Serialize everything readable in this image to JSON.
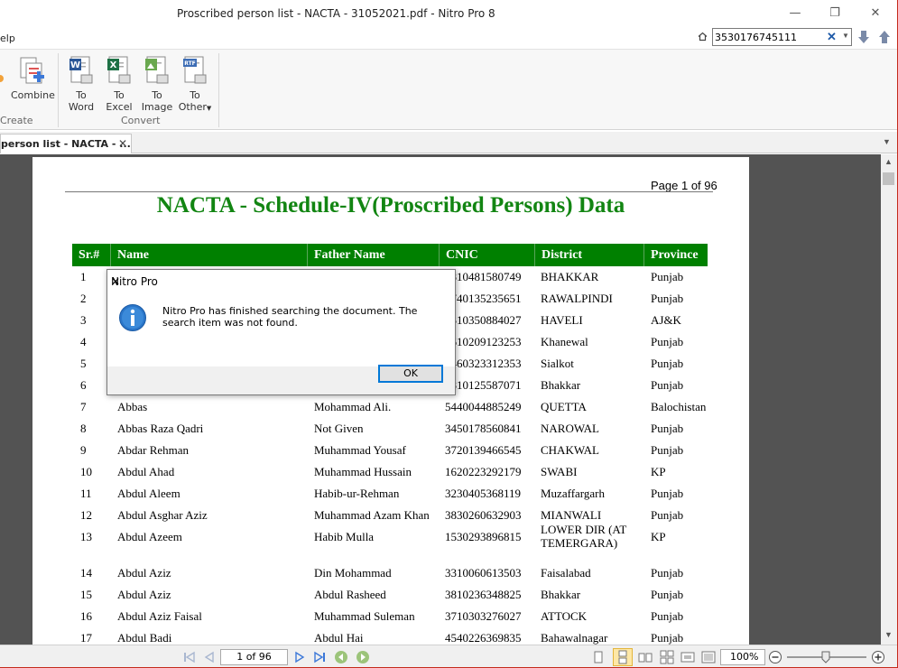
{
  "window": {
    "title": "Proscribed person list - NACTA - 31052021.pdf - Nitro Pro 8",
    "minimize_glyph": "—",
    "restore_glyph": "❐",
    "close_glyph": "✕"
  },
  "menu": {
    "help": "elp"
  },
  "search": {
    "value": "3530176745111",
    "clear_glyph": "✕"
  },
  "ribbon": {
    "create_group": {
      "combine_label": "Combine",
      "group_label": "Create"
    },
    "convert_group": {
      "group_label": "Convert",
      "buttons": [
        {
          "line1": "To",
          "line2": "Word",
          "icon": "word-icon",
          "badge": "W",
          "color": "#2b5797"
        },
        {
          "line1": "To",
          "line2": "Excel",
          "icon": "excel-icon",
          "badge": "X",
          "color": "#1e7145"
        },
        {
          "line1": "To",
          "line2": "Image",
          "icon": "image-icon",
          "badge": "IMG",
          "color": "#6aa84f"
        },
        {
          "line1": "To",
          "line2": "Other",
          "icon": "other-icon",
          "badge": "RTF",
          "color": "#3d6db5"
        }
      ]
    }
  },
  "tab": {
    "label": "person list - NACTA - ...",
    "close_glyph": "✕"
  },
  "document": {
    "page_label": "Page 1 of 96",
    "title": "NACTA - Schedule-IV(Proscribed Persons) Data",
    "columns": [
      "Sr.#",
      "Name",
      "Father Name",
      "CNIC",
      "District",
      "Province"
    ],
    "rows": [
      {
        "sr": "1",
        "name": "",
        "father": "",
        "cnic": "3810481580749",
        "district": "BHAKKAR",
        "province": "Punjab"
      },
      {
        "sr": "2",
        "name": "",
        "father": "",
        "cnic": "3740135235651",
        "district": "RAWALPINDI",
        "province": "Punjab"
      },
      {
        "sr": "3",
        "name": "",
        "father": "",
        "cnic": "1310350884027",
        "district": "HAVELI",
        "province": "AJ&K"
      },
      {
        "sr": "4",
        "name": "",
        "father": "",
        "cnic": "3610209123253",
        "district": "Khanewal",
        "province": "Punjab"
      },
      {
        "sr": "5",
        "name": "",
        "father": "",
        "cnic": "3460323312353",
        "district": "Sialkot",
        "province": "Punjab"
      },
      {
        "sr": "6",
        "name": "",
        "father": "",
        "cnic": "3810125587071",
        "district": "Bhakkar",
        "province": "Punjab"
      },
      {
        "sr": "7",
        "name": "Abbas",
        "father": "Mohammad Ali.",
        "cnic": "5440044885249",
        "district": "QUETTA",
        "province": "Balochistan"
      },
      {
        "sr": "8",
        "name": "Abbas Raza Qadri",
        "father": "Not Given",
        "cnic": "3450178560841",
        "district": "NAROWAL",
        "province": "Punjab"
      },
      {
        "sr": "9",
        "name": "Abdar Rehman",
        "father": "Muhammad Yousaf",
        "cnic": "3720139466545",
        "district": "CHAKWAL",
        "province": "Punjab"
      },
      {
        "sr": "10",
        "name": "Abdul Ahad",
        "father": "Muhammad Hussain",
        "cnic": "1620223292179",
        "district": "SWABI",
        "province": "KP"
      },
      {
        "sr": "11",
        "name": "Abdul Aleem",
        "father": "Habib-ur-Rehman",
        "cnic": "3230405368119",
        "district": "Muzaffargarh",
        "province": "Punjab"
      },
      {
        "sr": "12",
        "name": "Abdul Asghar Aziz",
        "father": "Muhammad Azam Khan",
        "cnic": "3830260632903",
        "district": "MIANWALI",
        "province": "Punjab"
      },
      {
        "sr": "13",
        "name": "Abdul Azeem",
        "father": "Habib Mulla",
        "cnic": "1530293896815",
        "district": "LOWER DIR (AT TEMERGARA)",
        "province": "KP"
      },
      {
        "sr": "14",
        "name": "Abdul Aziz",
        "father": "Din Mohammad",
        "cnic": "3310060613503",
        "district": "Faisalabad",
        "province": "Punjab"
      },
      {
        "sr": "15",
        "name": "Abdul Aziz",
        "father": "Abdul Rasheed",
        "cnic": "3810236348825",
        "district": "Bhakkar",
        "province": "Punjab"
      },
      {
        "sr": "16",
        "name": "Abdul Aziz Faisal",
        "father": "Muhammad Suleman",
        "cnic": "3710303276027",
        "district": "ATTOCK",
        "province": "Punjab"
      },
      {
        "sr": "17",
        "name": "Abdul Badi",
        "father": "Abdul Hai",
        "cnic": "4540226369835",
        "district": "Bahawalnagar",
        "province": "Punjab"
      }
    ]
  },
  "statusbar": {
    "page_field": "1 of 96",
    "zoom": "100%"
  },
  "dialog": {
    "title": "Nitro Pro",
    "message": "Nitro Pro has finished searching the document. The search item was not found.",
    "ok_label": "OK",
    "close_glyph": "✕"
  }
}
